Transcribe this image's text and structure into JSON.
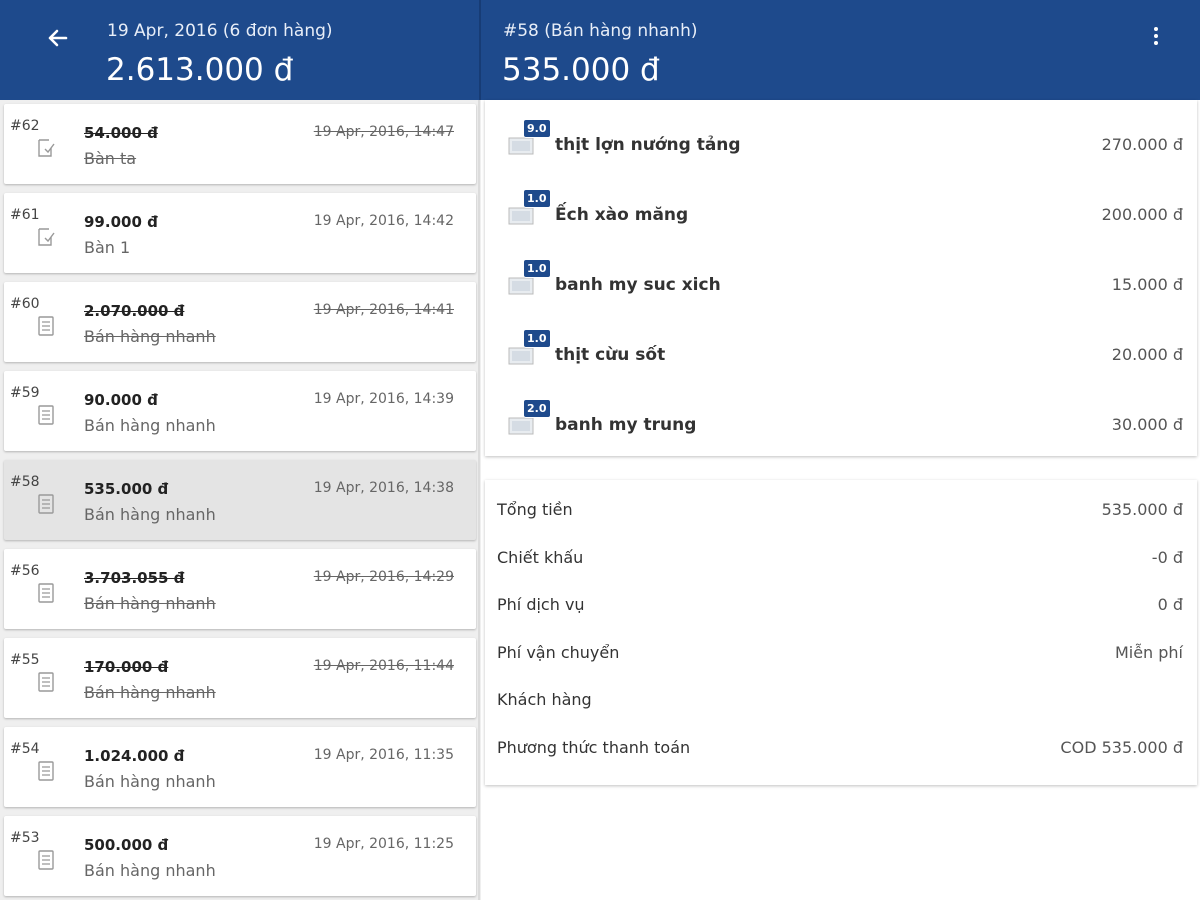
{
  "header": {
    "left_subtitle": "19 Apr, 2016  (6 đơn hàng)",
    "left_total": "2.613.000 đ",
    "right_subtitle": "#58 (Bán hàng nhanh)",
    "right_total": "535.000 đ",
    "back_icon": "arrow-left-icon",
    "menu_icon": "more-vertical-icon"
  },
  "orders": [
    {
      "id": "#62",
      "amount": "54.000 đ",
      "label": "Bàn  ta",
      "time": "19 Apr, 2016, 14:47",
      "icon": "checked-note-icon",
      "cancelled": true
    },
    {
      "id": "#61",
      "amount": "99.000 đ",
      "label": "Bàn  1",
      "time": "19 Apr, 2016, 14:42",
      "icon": "checked-note-icon",
      "cancelled": false
    },
    {
      "id": "#60",
      "amount": "2.070.000 đ",
      "label": "Bán hàng nhanh",
      "time": "19 Apr, 2016, 14:41",
      "icon": "receipt-icon",
      "cancelled": true
    },
    {
      "id": "#59",
      "amount": "90.000 đ",
      "label": "Bán hàng nhanh",
      "time": "19 Apr, 2016, 14:39",
      "icon": "receipt-icon",
      "cancelled": false
    },
    {
      "id": "#58",
      "amount": "535.000 đ",
      "label": "Bán hàng nhanh",
      "time": "19 Apr, 2016, 14:38",
      "icon": "receipt-icon",
      "cancelled": false,
      "selected": true
    },
    {
      "id": "#56",
      "amount": "3.703.055 đ",
      "label": "Bán hàng nhanh",
      "time": "19 Apr, 2016, 14:29",
      "icon": "receipt-icon",
      "cancelled": true
    },
    {
      "id": "#55",
      "amount": "170.000 đ",
      "label": "Bán hàng nhanh",
      "time": "19 Apr, 2016, 11:44",
      "icon": "receipt-icon",
      "cancelled": true
    },
    {
      "id": "#54",
      "amount": "1.024.000 đ",
      "label": "Bán hàng nhanh",
      "time": "19 Apr, 2016, 11:35",
      "icon": "receipt-icon",
      "cancelled": false
    },
    {
      "id": "#53",
      "amount": "500.000 đ",
      "label": "Bán hàng nhanh",
      "time": "19 Apr, 2016, 11:25",
      "icon": "receipt-icon",
      "cancelled": false
    }
  ],
  "items": [
    {
      "qty": "9.0",
      "name": "thịt lợn nướng tảng",
      "price": "270.000 đ"
    },
    {
      "qty": "1.0",
      "name": "Ếch xào măng",
      "price": "200.000 đ"
    },
    {
      "qty": "1.0",
      "name": "banh my suc xich",
      "price": "15.000 đ"
    },
    {
      "qty": "1.0",
      "name": "thịt cừu sốt",
      "price": "20.000 đ"
    },
    {
      "qty": "2.0",
      "name": "banh my trung",
      "price": "30.000 đ"
    }
  ],
  "summary": [
    {
      "label": "Tổng tiền",
      "value": "535.000 đ"
    },
    {
      "label": "Chiết khấu",
      "value": "-0 đ"
    },
    {
      "label": "Phí dịch vụ",
      "value": "0 đ"
    },
    {
      "label": "Phí vận chuyển",
      "value": "Miễn phí"
    },
    {
      "label": "Khách hàng",
      "value": ""
    },
    {
      "label": "Phương thức thanh toán",
      "value": "COD 535.000 đ"
    }
  ],
  "colors": {
    "header": "#1e4a8c",
    "selected_row": "#e4e4e4",
    "badge": "#1e4a8c"
  }
}
